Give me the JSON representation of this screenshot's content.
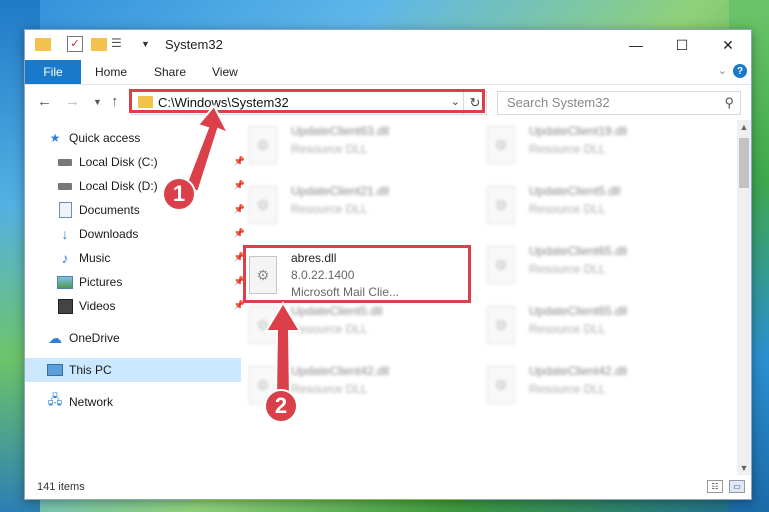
{
  "window": {
    "title": "System32",
    "controls": {
      "minimize": "—",
      "maximize": "☐",
      "close": "✕"
    }
  },
  "ribbon": {
    "tabs": [
      "File",
      "Home",
      "Share",
      "View"
    ],
    "help": "?"
  },
  "nav": {
    "address": "C:\\Windows\\System32",
    "search_placeholder": "Search System32"
  },
  "sidebar": {
    "items": [
      {
        "label": "Quick access",
        "icon": "star-icon"
      },
      {
        "label": "Local Disk (C:)",
        "icon": "drive-icon"
      },
      {
        "label": "Local Disk (D:)",
        "icon": "drive-icon"
      },
      {
        "label": "Documents",
        "icon": "documents-icon"
      },
      {
        "label": "Downloads",
        "icon": "download-icon"
      },
      {
        "label": "Music",
        "icon": "music-icon"
      },
      {
        "label": "Pictures",
        "icon": "pictures-icon"
      },
      {
        "label": "Videos",
        "icon": "videos-icon"
      },
      {
        "label": "OneDrive",
        "icon": "cloud-icon"
      },
      {
        "label": "This PC",
        "icon": "computer-icon"
      },
      {
        "label": "Network",
        "icon": "network-icon"
      }
    ]
  },
  "files": [
    {
      "name": "UpdateClient63.dll",
      "type": "Resource DLL"
    },
    {
      "name": "UpdateClient19.dll",
      "type": "Resource DLL"
    },
    {
      "name": "UpdateClient21.dll",
      "type": "Resource DLL"
    },
    {
      "name": "UpdateClient5.dll",
      "type": "Resource DLL"
    },
    {
      "name": "abres.dll",
      "version": "8.0.22.1400",
      "desc": "Microsoft Mail Clie..."
    },
    {
      "name": "UpdateClient65.dll",
      "type": "Resource DLL"
    },
    {
      "name": "UpdateClient5.dll",
      "type": "Resource DLL"
    },
    {
      "name": "UpdateClient65.dll",
      "type": "Resource DLL"
    },
    {
      "name": "UpdateClient42.dll",
      "type": "Resource DLL"
    },
    {
      "name": "UpdateClient42.dll",
      "type": "Resource DLL"
    }
  ],
  "status": {
    "count": "141 items"
  },
  "callouts": {
    "one": "1",
    "two": "2"
  },
  "colors": {
    "accent": "#1979ca",
    "highlight": "#d9404a",
    "selected": "#cce8ff"
  }
}
